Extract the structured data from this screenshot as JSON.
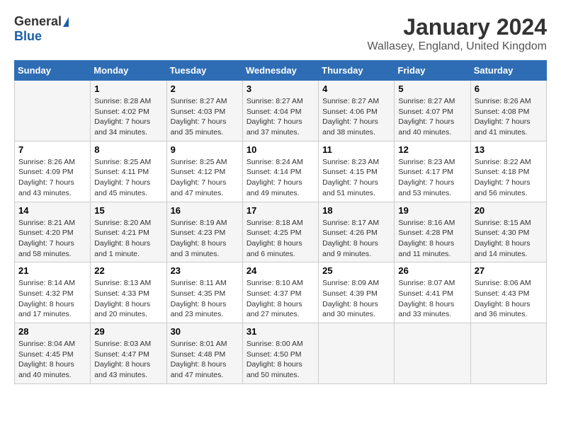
{
  "logo": {
    "general": "General",
    "blue": "Blue"
  },
  "title": "January 2024",
  "location": "Wallasey, England, United Kingdom",
  "days_header": [
    "Sunday",
    "Monday",
    "Tuesday",
    "Wednesday",
    "Thursday",
    "Friday",
    "Saturday"
  ],
  "weeks": [
    [
      {
        "day": "",
        "sunrise": "",
        "sunset": "",
        "daylight": ""
      },
      {
        "day": "1",
        "sunrise": "Sunrise: 8:28 AM",
        "sunset": "Sunset: 4:02 PM",
        "daylight": "Daylight: 7 hours and 34 minutes."
      },
      {
        "day": "2",
        "sunrise": "Sunrise: 8:27 AM",
        "sunset": "Sunset: 4:03 PM",
        "daylight": "Daylight: 7 hours and 35 minutes."
      },
      {
        "day": "3",
        "sunrise": "Sunrise: 8:27 AM",
        "sunset": "Sunset: 4:04 PM",
        "daylight": "Daylight: 7 hours and 37 minutes."
      },
      {
        "day": "4",
        "sunrise": "Sunrise: 8:27 AM",
        "sunset": "Sunset: 4:06 PM",
        "daylight": "Daylight: 7 hours and 38 minutes."
      },
      {
        "day": "5",
        "sunrise": "Sunrise: 8:27 AM",
        "sunset": "Sunset: 4:07 PM",
        "daylight": "Daylight: 7 hours and 40 minutes."
      },
      {
        "day": "6",
        "sunrise": "Sunrise: 8:26 AM",
        "sunset": "Sunset: 4:08 PM",
        "daylight": "Daylight: 7 hours and 41 minutes."
      }
    ],
    [
      {
        "day": "7",
        "sunrise": "Sunrise: 8:26 AM",
        "sunset": "Sunset: 4:09 PM",
        "daylight": "Daylight: 7 hours and 43 minutes."
      },
      {
        "day": "8",
        "sunrise": "Sunrise: 8:25 AM",
        "sunset": "Sunset: 4:11 PM",
        "daylight": "Daylight: 7 hours and 45 minutes."
      },
      {
        "day": "9",
        "sunrise": "Sunrise: 8:25 AM",
        "sunset": "Sunset: 4:12 PM",
        "daylight": "Daylight: 7 hours and 47 minutes."
      },
      {
        "day": "10",
        "sunrise": "Sunrise: 8:24 AM",
        "sunset": "Sunset: 4:14 PM",
        "daylight": "Daylight: 7 hours and 49 minutes."
      },
      {
        "day": "11",
        "sunrise": "Sunrise: 8:23 AM",
        "sunset": "Sunset: 4:15 PM",
        "daylight": "Daylight: 7 hours and 51 minutes."
      },
      {
        "day": "12",
        "sunrise": "Sunrise: 8:23 AM",
        "sunset": "Sunset: 4:17 PM",
        "daylight": "Daylight: 7 hours and 53 minutes."
      },
      {
        "day": "13",
        "sunrise": "Sunrise: 8:22 AM",
        "sunset": "Sunset: 4:18 PM",
        "daylight": "Daylight: 7 hours and 56 minutes."
      }
    ],
    [
      {
        "day": "14",
        "sunrise": "Sunrise: 8:21 AM",
        "sunset": "Sunset: 4:20 PM",
        "daylight": "Daylight: 7 hours and 58 minutes."
      },
      {
        "day": "15",
        "sunrise": "Sunrise: 8:20 AM",
        "sunset": "Sunset: 4:21 PM",
        "daylight": "Daylight: 8 hours and 1 minute."
      },
      {
        "day": "16",
        "sunrise": "Sunrise: 8:19 AM",
        "sunset": "Sunset: 4:23 PM",
        "daylight": "Daylight: 8 hours and 3 minutes."
      },
      {
        "day": "17",
        "sunrise": "Sunrise: 8:18 AM",
        "sunset": "Sunset: 4:25 PM",
        "daylight": "Daylight: 8 hours and 6 minutes."
      },
      {
        "day": "18",
        "sunrise": "Sunrise: 8:17 AM",
        "sunset": "Sunset: 4:26 PM",
        "daylight": "Daylight: 8 hours and 9 minutes."
      },
      {
        "day": "19",
        "sunrise": "Sunrise: 8:16 AM",
        "sunset": "Sunset: 4:28 PM",
        "daylight": "Daylight: 8 hours and 11 minutes."
      },
      {
        "day": "20",
        "sunrise": "Sunrise: 8:15 AM",
        "sunset": "Sunset: 4:30 PM",
        "daylight": "Daylight: 8 hours and 14 minutes."
      }
    ],
    [
      {
        "day": "21",
        "sunrise": "Sunrise: 8:14 AM",
        "sunset": "Sunset: 4:32 PM",
        "daylight": "Daylight: 8 hours and 17 minutes."
      },
      {
        "day": "22",
        "sunrise": "Sunrise: 8:13 AM",
        "sunset": "Sunset: 4:33 PM",
        "daylight": "Daylight: 8 hours and 20 minutes."
      },
      {
        "day": "23",
        "sunrise": "Sunrise: 8:11 AM",
        "sunset": "Sunset: 4:35 PM",
        "daylight": "Daylight: 8 hours and 23 minutes."
      },
      {
        "day": "24",
        "sunrise": "Sunrise: 8:10 AM",
        "sunset": "Sunset: 4:37 PM",
        "daylight": "Daylight: 8 hours and 27 minutes."
      },
      {
        "day": "25",
        "sunrise": "Sunrise: 8:09 AM",
        "sunset": "Sunset: 4:39 PM",
        "daylight": "Daylight: 8 hours and 30 minutes."
      },
      {
        "day": "26",
        "sunrise": "Sunrise: 8:07 AM",
        "sunset": "Sunset: 4:41 PM",
        "daylight": "Daylight: 8 hours and 33 minutes."
      },
      {
        "day": "27",
        "sunrise": "Sunrise: 8:06 AM",
        "sunset": "Sunset: 4:43 PM",
        "daylight": "Daylight: 8 hours and 36 minutes."
      }
    ],
    [
      {
        "day": "28",
        "sunrise": "Sunrise: 8:04 AM",
        "sunset": "Sunset: 4:45 PM",
        "daylight": "Daylight: 8 hours and 40 minutes."
      },
      {
        "day": "29",
        "sunrise": "Sunrise: 8:03 AM",
        "sunset": "Sunset: 4:47 PM",
        "daylight": "Daylight: 8 hours and 43 minutes."
      },
      {
        "day": "30",
        "sunrise": "Sunrise: 8:01 AM",
        "sunset": "Sunset: 4:48 PM",
        "daylight": "Daylight: 8 hours and 47 minutes."
      },
      {
        "day": "31",
        "sunrise": "Sunrise: 8:00 AM",
        "sunset": "Sunset: 4:50 PM",
        "daylight": "Daylight: 8 hours and 50 minutes."
      },
      {
        "day": "",
        "sunrise": "",
        "sunset": "",
        "daylight": ""
      },
      {
        "day": "",
        "sunrise": "",
        "sunset": "",
        "daylight": ""
      },
      {
        "day": "",
        "sunrise": "",
        "sunset": "",
        "daylight": ""
      }
    ]
  ]
}
